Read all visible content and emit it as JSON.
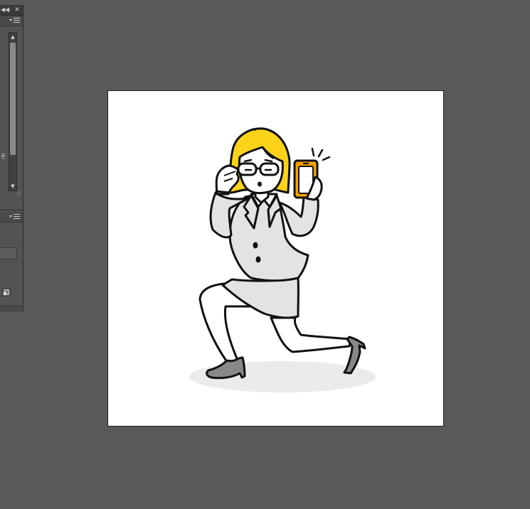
{
  "panel": {
    "collapse_icon": "double-left-arrow-icon",
    "close_icon": "close-icon",
    "menu_icon": "panel-menu-icon",
    "side_glyph": "そ"
  },
  "artboard": {
    "background": "#ffffff"
  },
  "illustration": {
    "subject": "businesswoman-with-glasses-and-smartphone",
    "colors": {
      "hair": "#FDD31A",
      "phone": "#F5A100",
      "suit": "#E3E3E3",
      "shoes": "#888888",
      "shadow": "#EBEBEB",
      "outline": "#111111"
    }
  }
}
